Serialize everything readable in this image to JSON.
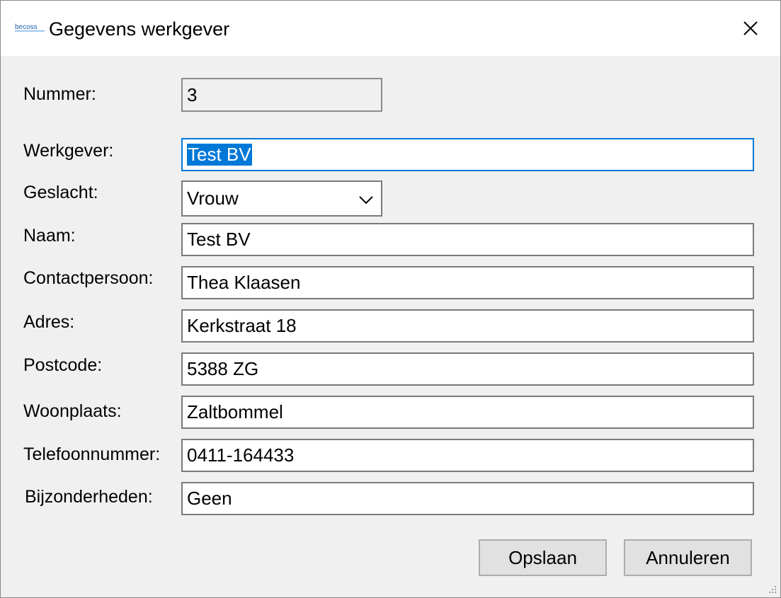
{
  "window": {
    "title": "Gegevens werkgever",
    "logo_text": "becoss"
  },
  "form": {
    "nummer": {
      "label": "Nummer:",
      "value": "3"
    },
    "werkgever": {
      "label": "Werkgever:",
      "value": "Test BV"
    },
    "geslacht": {
      "label": "Geslacht:",
      "value": "Vrouw"
    },
    "naam": {
      "label": "Naam:",
      "value": "Test BV"
    },
    "contactpersoon": {
      "label": "Contactpersoon:",
      "value": "Thea Klaasen"
    },
    "adres": {
      "label": "Adres:",
      "value": "Kerkstraat 18"
    },
    "postcode": {
      "label": "Postcode:",
      "value": "5388 ZG"
    },
    "woonplaats": {
      "label": "Woonplaats:",
      "value": "Zaltbommel"
    },
    "telefoonnummer": {
      "label": "Telefoonnummer:",
      "value": "0411-164433"
    },
    "bijzonderheden": {
      "label": "Bijzonderheden:",
      "value": "Geen"
    }
  },
  "buttons": {
    "save": "Opslaan",
    "cancel": "Annuleren"
  },
  "colors": {
    "accent": "#0078d7",
    "window_bg": "#f0f0f0",
    "titlebar_bg": "#ffffff"
  }
}
